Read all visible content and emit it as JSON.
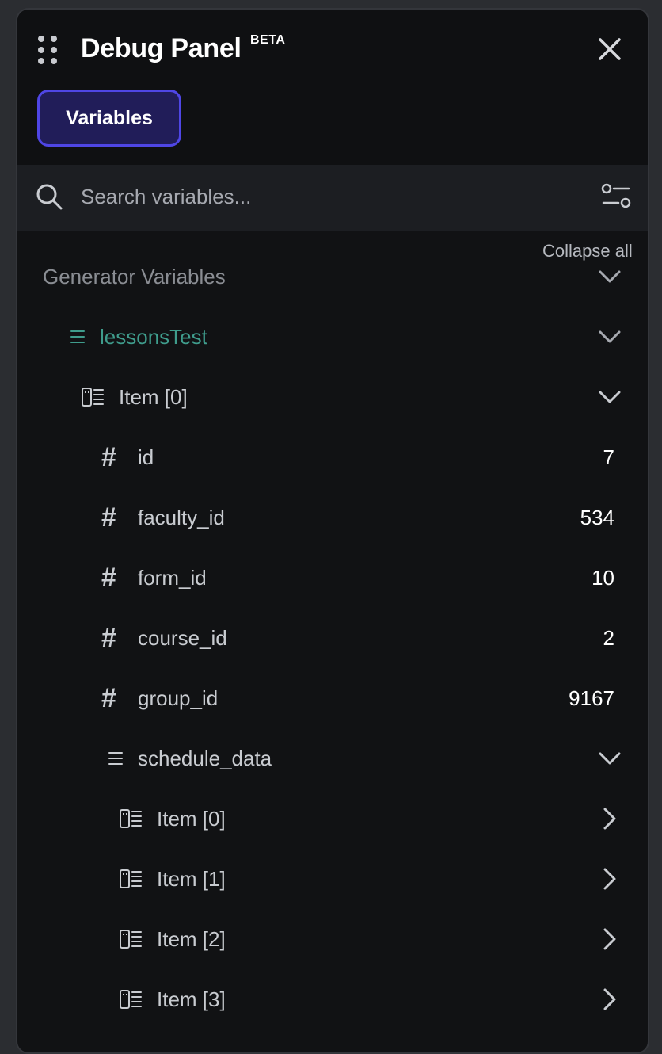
{
  "header": {
    "title": "Debug Panel",
    "badge": "BETA",
    "tab_label": "Variables"
  },
  "search": {
    "placeholder": "Search variables..."
  },
  "collapse_all_label": "Collapse all",
  "tree": {
    "section_label": "Generator Variables",
    "list_name": "lessonsTest",
    "item_label": "Item [0]",
    "fields": [
      {
        "name": "id",
        "value": "7"
      },
      {
        "name": "faculty_id",
        "value": "534"
      },
      {
        "name": "form_id",
        "value": "10"
      },
      {
        "name": "course_id",
        "value": "2"
      },
      {
        "name": "group_id",
        "value": "9167"
      }
    ],
    "nested_list_name": "schedule_data",
    "nested_items": [
      "Item [0]",
      "Item [1]",
      "Item [2]",
      "Item [3]"
    ]
  },
  "colors": {
    "accent": "#4f46e5",
    "list_name_color": "#3f9c8c",
    "section_color": "#8a8d93"
  }
}
